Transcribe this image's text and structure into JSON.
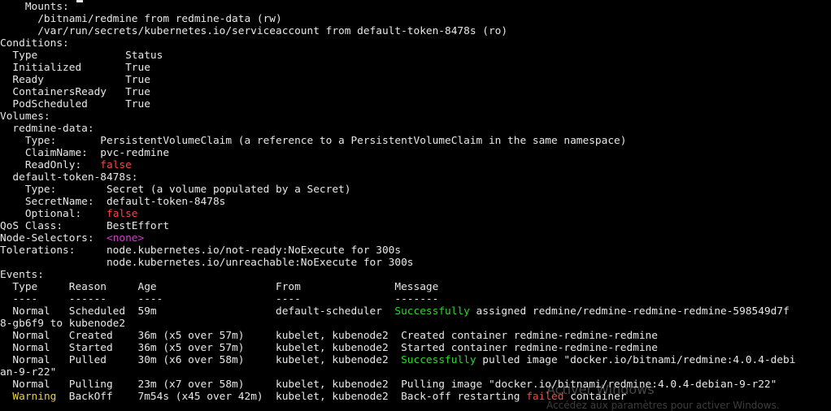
{
  "terminal": {
    "lines": [
      [
        {
          "t": "    Mounts:"
        }
      ],
      [
        {
          "t": "      /bitnami/redmine from redmine-data (rw)"
        }
      ],
      [
        {
          "t": "      /var/run/secrets/kubernetes.io/serviceaccount from default-token-8478s (ro)"
        }
      ],
      [
        {
          "t": "Conditions:"
        }
      ],
      [
        {
          "t": "  Type              Status"
        }
      ],
      [
        {
          "t": "  Initialized       True"
        }
      ],
      [
        {
          "t": "  Ready             True"
        }
      ],
      [
        {
          "t": "  ContainersReady   True"
        }
      ],
      [
        {
          "t": "  PodScheduled      True"
        }
      ],
      [
        {
          "t": "Volumes:"
        }
      ],
      [
        {
          "t": "  redmine-data:"
        }
      ],
      [
        {
          "t": "    Type:       PersistentVolumeClaim (a reference to a PersistentVolumeClaim in the same namespace)"
        }
      ],
      [
        {
          "t": "    ClaimName:  pvc-redmine"
        }
      ],
      [
        {
          "t": "    ReadOnly:   "
        },
        {
          "t": "false",
          "c": "red"
        }
      ],
      [
        {
          "t": "  default-token-8478s:"
        }
      ],
      [
        {
          "t": "    Type:        Secret (a volume populated by a Secret)"
        }
      ],
      [
        {
          "t": "    SecretName:  default-token-8478s"
        }
      ],
      [
        {
          "t": "    Optional:    "
        },
        {
          "t": "false",
          "c": "red"
        }
      ],
      [
        {
          "t": "QoS Class:       BestEffort"
        }
      ],
      [
        {
          "t": "Node-Selectors:  "
        },
        {
          "t": "<none>",
          "c": "magenta"
        }
      ],
      [
        {
          "t": "Tolerations:     node.kubernetes.io/not-ready:NoExecute for 300s"
        }
      ],
      [
        {
          "t": "                 node.kubernetes.io/unreachable:NoExecute for 300s"
        }
      ],
      [
        {
          "t": "Events:"
        }
      ],
      [
        {
          "t": "  Type     Reason     Age                   From               Message"
        }
      ],
      [
        {
          "t": "  ----     ------     ----                  ----               -------"
        }
      ],
      [
        {
          "t": "  Normal   Scheduled  59m                   default-scheduler  "
        },
        {
          "t": "Successfully",
          "c": "green"
        },
        {
          "t": " assigned redmine/redmine-redmine-redmine-598549d7f"
        }
      ],
      [
        {
          "t": "8-gb6f9 to kubenode2"
        }
      ],
      [
        {
          "t": "  Normal   Created    36m (x5 over 57m)     kubelet, kubenode2  Created container redmine-redmine-redmine"
        }
      ],
      [
        {
          "t": "  Normal   Started    36m (x5 over 57m)     kubelet, kubenode2  Started container redmine-redmine-redmine"
        }
      ],
      [
        {
          "t": "  Normal   Pulled     30m (x6 over 58m)     kubelet, kubenode2  "
        },
        {
          "t": "Successfully",
          "c": "green"
        },
        {
          "t": " pulled image \"docker.io/bitnami/redmine:4.0.4-debi"
        }
      ],
      [
        {
          "t": "an-9-r22\""
        }
      ],
      [
        {
          "t": "  Normal   Pulling    23m (x7 over 58m)     kubelet, kubenode2  Pulling image \"docker.io/bitnami/redmine:4.0.4-debian-9-r22\""
        }
      ],
      [
        {
          "t": "  "
        },
        {
          "t": "Warning",
          "c": "yellow"
        },
        {
          "t": "  BackOff    7m54s (x45 over 42m)  kubelet, kubenode2  Back-off restarting "
        },
        {
          "t": "failed",
          "c": "red"
        },
        {
          "t": " container"
        }
      ]
    ]
  },
  "watermark": {
    "title": "Activer Windows",
    "subtitle": "Accédez aux paramètres pour activer Windows."
  },
  "colors": {
    "background": "#000000",
    "foreground": "#e8e8e8",
    "green": "#2fd52f",
    "red": "#f04848",
    "magenta": "#d040d0",
    "yellow": "#e8d23c"
  }
}
